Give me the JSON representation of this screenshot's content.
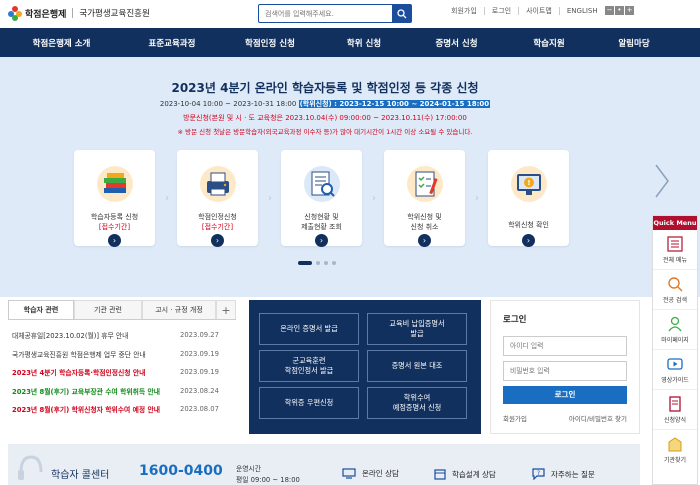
{
  "header": {
    "logo_text": "학점은행제",
    "org_name": "국가평생교육진흥원",
    "search_placeholder": "검색어를 입력해주세요.",
    "links": [
      "회원가입",
      "로그인",
      "사이트맵",
      "ENGLISH"
    ],
    "font_controls": [
      "−",
      "•",
      "+"
    ]
  },
  "nav": {
    "items": [
      "학점은행제 소개",
      "표준교육과정",
      "학점인정 신청",
      "학위 신청",
      "증명서 신청",
      "학습지원",
      "알림마당"
    ]
  },
  "hero": {
    "title": "2023년 4분기 온라인 학습자등록 및 학점인정 등 각종 신청",
    "date_main": "2023-10-04 10:00 ~ 2023-10-31 18:00",
    "date_highlight": "(학위신청) : 2023-12-15 10:00 ~ 2024-01-15 18:00",
    "red_line1": "방문신청(본원 및 시 · 도 교육청은 2023.10.04(수) 09:00:00 ~ 2023.10.11(수) 17:00:00",
    "red_line2": "※ 방문 신청 첫날은 방문학습자(외국교육과정 이수자 등)가 많아 대기시간이 1시간 이상 소요될 수 있습니다.",
    "cards": [
      {
        "line1": "학습자등록 신청",
        "line2": "[접수기간]",
        "icon": "books-icon"
      },
      {
        "line1": "학점인정신청",
        "line2": "[접수기간]",
        "icon": "printer-icon"
      },
      {
        "line1": "신청현황 및",
        "line2": "제출현황 조회",
        "icon": "document-search-icon"
      },
      {
        "line1": "학위신청 및",
        "line2": "신청 취소",
        "icon": "checklist-icon"
      },
      {
        "line1": "학위신청 확인",
        "line2": "",
        "icon": "alert-monitor-icon"
      }
    ],
    "slides": 4,
    "active_slide": 1
  },
  "notice": {
    "tabs": [
      "학습자 관련",
      "기관 관련",
      "고시 · 규정 개정"
    ],
    "items": [
      {
        "title": "대체공휴일[2023.10.02(월)] 휴무 안내",
        "date": "2023.09.27",
        "style": "normal"
      },
      {
        "title": "국가평생교육진흥원 학점은행제 업무 중단 안내",
        "date": "2023.09.19",
        "style": "normal"
      },
      {
        "title": "2023년 4분기 학습자등록·학점인정신청 안내",
        "date": "2023.09.19",
        "style": "red"
      },
      {
        "title": "2023년 8월(후기) 교육부장관 수여 학위취득 안내",
        "date": "2023.08.24",
        "style": "green"
      },
      {
        "title": "2023년 8월(후기) 학위신청자 학위수여 예정 안내",
        "date": "2023.08.07",
        "style": "red"
      }
    ]
  },
  "quick": {
    "buttons": [
      "온라인 증명서 발급",
      "교육비 납입증명서\n발급",
      "군교육훈련\n학점인정서 발급",
      "증명서 원본 대조",
      "학위증 우편신청",
      "학위수여\n예정증명서 신청"
    ]
  },
  "login": {
    "title": "로그인",
    "id_placeholder": "아이디 입력",
    "pw_placeholder": "비밀번호 입력",
    "button": "로그인",
    "links": [
      "회원가입",
      "아이디/비밀번호 찾기"
    ]
  },
  "callcenter": {
    "label": "학습자 콜센터",
    "number": "1600-0400",
    "hours_label": "운영시간",
    "hours": "평일 09:00 ~ 18:00",
    "links": [
      "온라인 상담",
      "학습설계 상담",
      "자주하는 질문"
    ]
  },
  "quickmenu": {
    "title": "Quick Menu",
    "items": [
      "전체 메뉴",
      "전공 검색",
      "마이페이지",
      "영상가이드",
      "신청양식",
      "기관찾기"
    ]
  }
}
